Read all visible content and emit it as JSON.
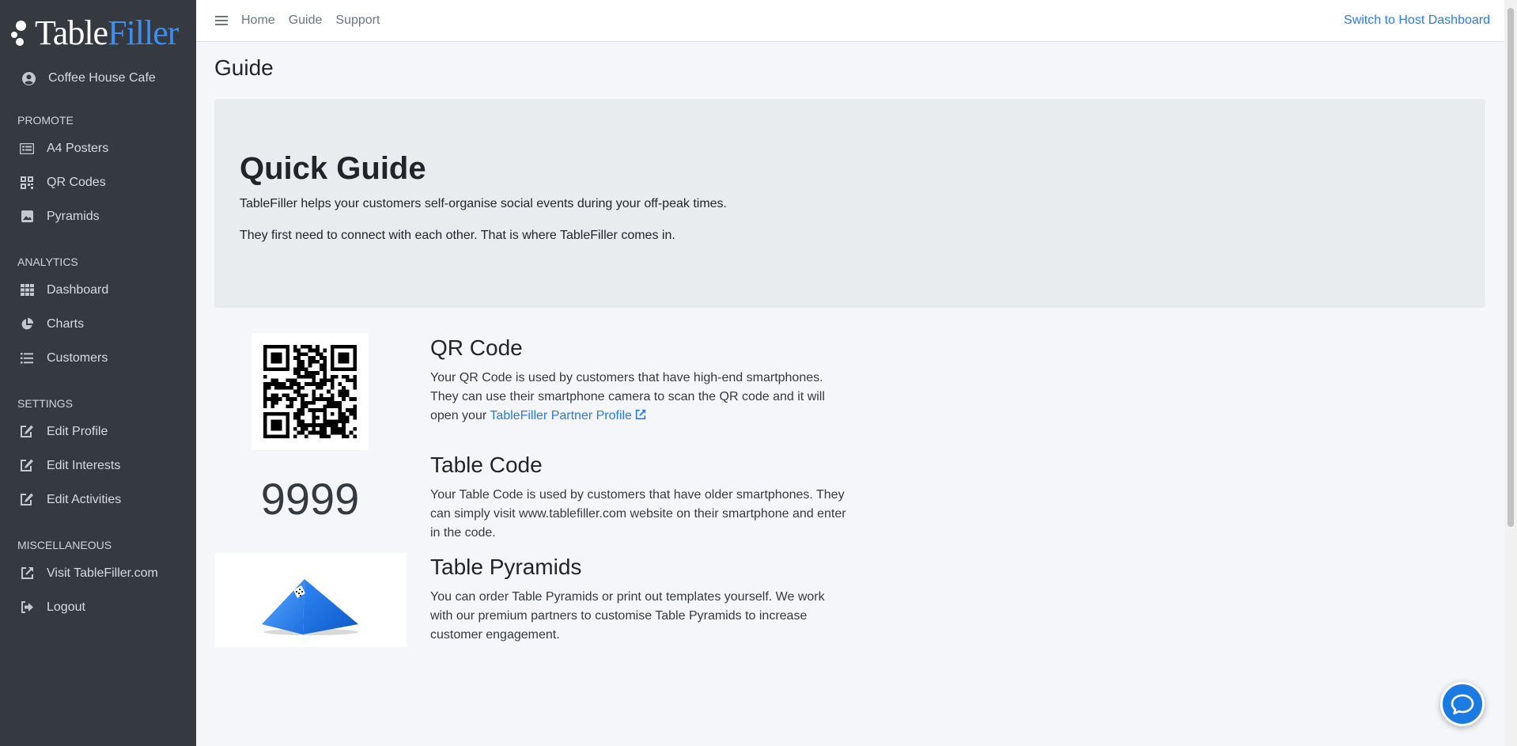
{
  "brand": {
    "name_main": "Table",
    "name_accent": "Filler"
  },
  "sidebar": {
    "user": "Coffee House Cafe",
    "sections": [
      {
        "header": "PROMOTE",
        "items": [
          {
            "label": "A4 Posters",
            "icon": "poster-icon"
          },
          {
            "label": "QR Codes",
            "icon": "qrcode-icon"
          },
          {
            "label": "Pyramids",
            "icon": "image-icon"
          }
        ]
      },
      {
        "header": "ANALYTICS",
        "items": [
          {
            "label": "Dashboard",
            "icon": "grid-icon"
          },
          {
            "label": "Charts",
            "icon": "pie-chart-icon"
          },
          {
            "label": "Customers",
            "icon": "list-icon"
          }
        ]
      },
      {
        "header": "SETTINGS",
        "items": [
          {
            "label": "Edit Profile",
            "icon": "edit-icon"
          },
          {
            "label": "Edit Interests",
            "icon": "edit-icon"
          },
          {
            "label": "Edit Activities",
            "icon": "edit-icon"
          }
        ]
      },
      {
        "header": "MISCELLANEOUS",
        "items": [
          {
            "label": "Visit TableFiller.com",
            "icon": "external-link-icon"
          },
          {
            "label": "Logout",
            "icon": "logout-icon"
          }
        ]
      }
    ]
  },
  "topbar": {
    "links": [
      "Home",
      "Guide",
      "Support"
    ],
    "switch_label": "Switch to Host Dashboard"
  },
  "page": {
    "title": "Guide",
    "jumbotron": {
      "heading": "Quick Guide",
      "line1": "TableFiller helps your customers self-organise social events during your off-peak times.",
      "line2": "They first need to connect with each other. That is where TableFiller comes in."
    },
    "qr": {
      "heading": "QR Code",
      "text": "Your QR Code is used by customers that have high-end smartphones. They can use their smartphone camera to scan the QR code and it will open your ",
      "link": "TableFiller Partner Profile"
    },
    "table_code": {
      "value": "9999",
      "heading": "Table Code",
      "text": "Your Table Code is used by customers that have older smartphones. They can simply visit www.tablefiller.com website on their smartphone and enter in the code."
    },
    "pyramids": {
      "heading": "Table Pyramids",
      "text": "You can order Table Pyramids or print out templates yourself. We work with our premium partners to customise Table Pyramids to increase customer engagement."
    }
  },
  "colors": {
    "sidebar_bg": "#343a40",
    "accent": "#2a7ae2",
    "brand_accent": "#3d8ef0",
    "chat_button": "#1c7be2"
  }
}
